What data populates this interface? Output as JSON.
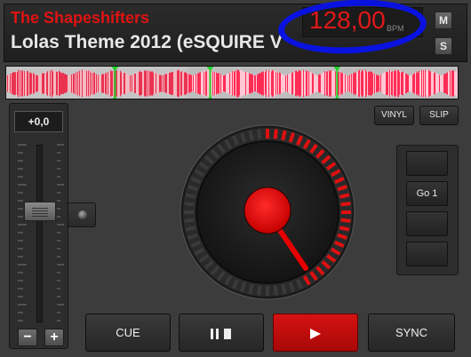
{
  "deck": {
    "artist": "The Shapeshifters",
    "title": "Lolas Theme 2012 (eSQUIRE V",
    "bpm_value": "128,00",
    "bpm_unit": "BPM",
    "btn_m": "M",
    "btn_s": "S"
  },
  "pitch": {
    "readout": "+0,0",
    "slider_fraction": 0.5,
    "minus_label": "−",
    "plus_label": "+"
  },
  "modes": {
    "vinyl": "VINYL",
    "slip": "SLIP"
  },
  "hotcues": [
    "",
    "Go 1",
    "",
    ""
  ],
  "transport": {
    "cue": "CUE",
    "sync": "SYNC"
  },
  "waveform": {
    "played_fraction": 0.4,
    "cue_markers_fraction": [
      0.24,
      0.45,
      0.73
    ]
  },
  "colors": {
    "accent_red": "#e01313",
    "annotation_blue": "#0a12e0",
    "waveform_played": "#f0f0f0",
    "waveform_remaining": "#e8163a"
  },
  "icons": {
    "pause": "pause-icon",
    "play": "play-icon",
    "pitch_ext": "knob-icon"
  }
}
